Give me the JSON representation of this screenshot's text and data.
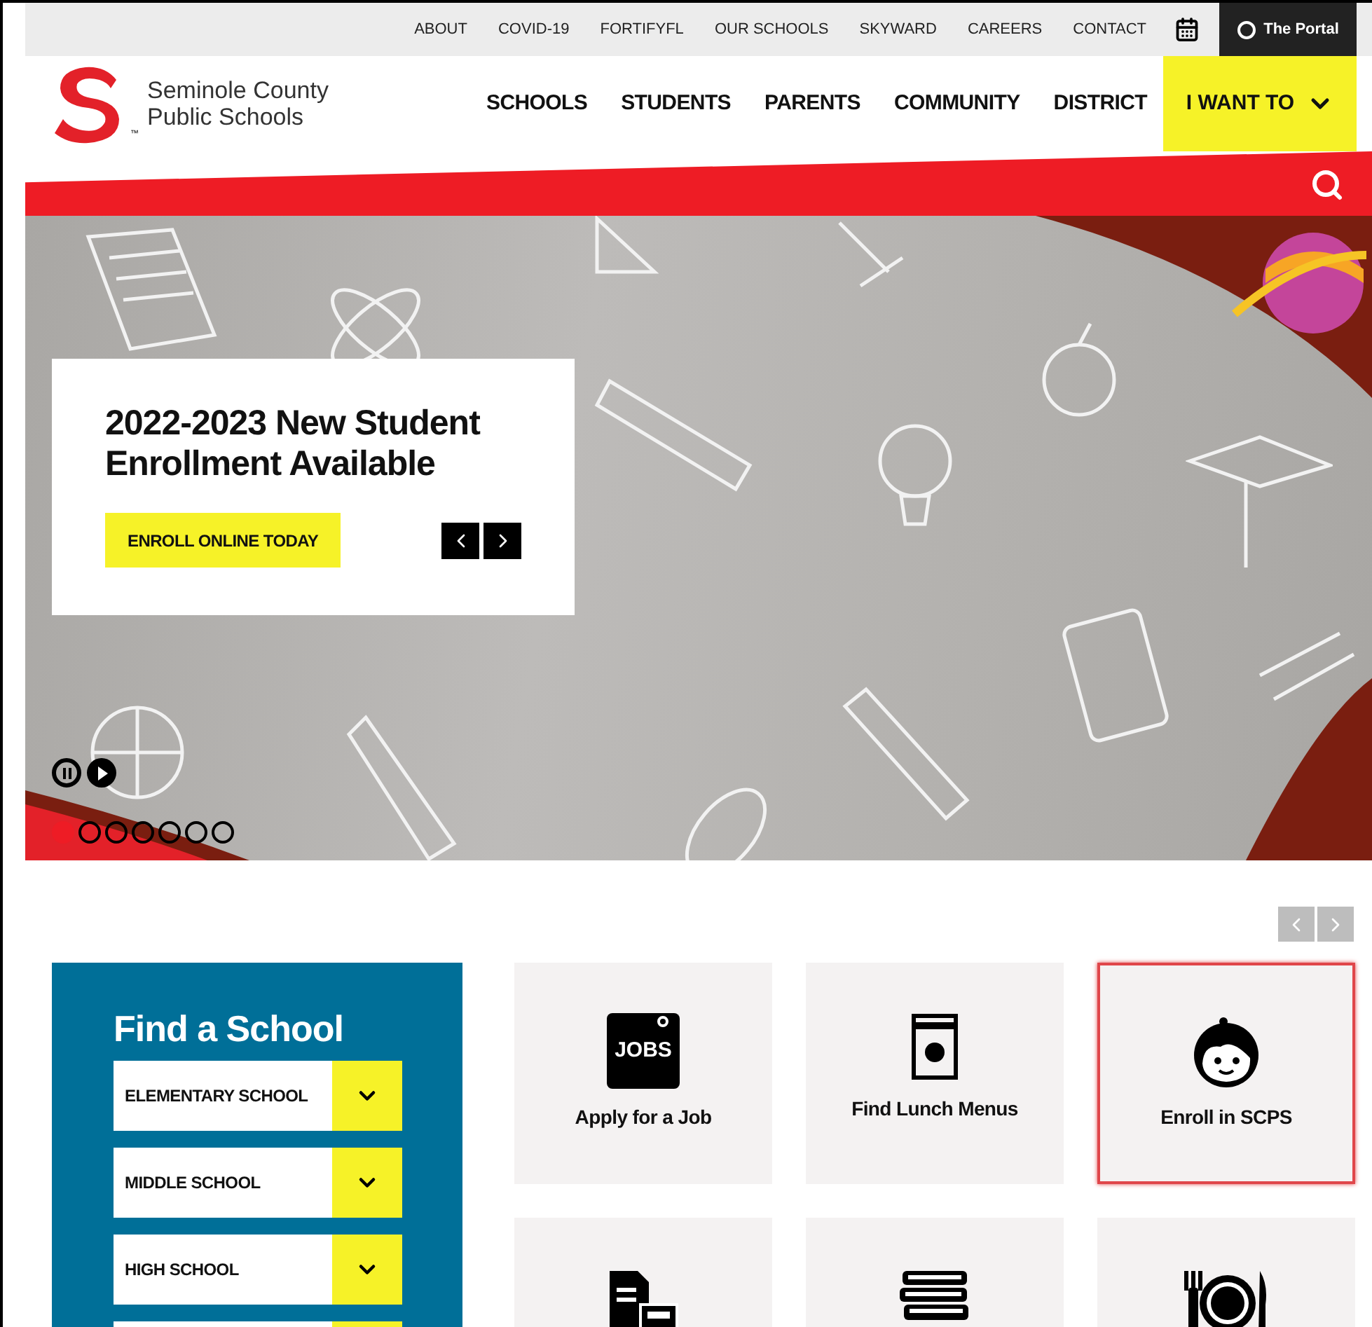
{
  "utility_nav": [
    "ABOUT",
    "COVID-19",
    "FORTIFYFL",
    "OUR SCHOOLS",
    "SKYWARD",
    "CAREERS",
    "CONTACT"
  ],
  "portal_button": "The Portal",
  "logo": {
    "line_1": "Seminole County",
    "line_2": "Public Schools",
    "mark": "™"
  },
  "main_nav": [
    "SCHOOLS",
    "STUDENTS",
    "PARENTS",
    "COMMUNITY",
    "DISTRICT"
  ],
  "i_want_to": "I WANT TO",
  "hero": {
    "title": "2022-2023 New Student Enrollment Available",
    "button": "ENROLL ONLINE TODAY",
    "slides": [
      {
        "selected": true
      },
      {
        "selected": false
      },
      {
        "selected": false
      },
      {
        "selected": false
      },
      {
        "selected": false
      },
      {
        "selected": false
      },
      {
        "selected": false
      }
    ]
  },
  "find_a_school": {
    "title": "Find a School",
    "dropdowns": [
      "ELEMENTARY SCHOOL",
      "MIDDLE SCHOOL",
      "HIGH SCHOOL"
    ]
  },
  "quick_links": [
    {
      "kind": "jobs",
      "label": "Apply for a Job",
      "icon_text": "JOBS",
      "highlighted": false
    },
    {
      "kind": "lunch",
      "label": "Find Lunch Menus",
      "highlighted": false
    },
    {
      "kind": "child",
      "label": "Enroll in SCPS",
      "highlighted": true
    },
    {
      "kind": "documents",
      "highlighted": false
    },
    {
      "kind": "books",
      "highlighted": false
    },
    {
      "kind": "meal",
      "highlighted": false
    }
  ]
}
